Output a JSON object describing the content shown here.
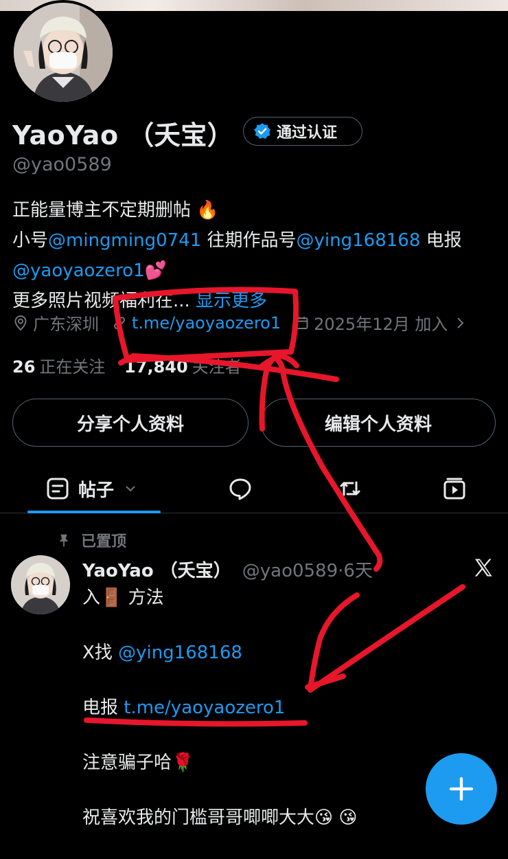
{
  "profile": {
    "name": "YaoYao （夭宝）",
    "verified_label": "通过认证",
    "handle": "@yao0589",
    "bio_line1": "正能量博主不定期删帖 🔥",
    "bio_line2_prefix": "小号",
    "bio_line2_link1": "@mingming0741",
    "bio_line2_mid": " 往期作品号",
    "bio_line2_link2": "@ying168168",
    "bio_line2_suffix": " 电报",
    "bio_line3_link": "@yaoyaozero1",
    "bio_line3_emoji": "💕",
    "bio_line4": "更多照片视频福利在...",
    "bio_line4_more": " 显示更多",
    "location": "广东深圳",
    "website": "t.me/yaoyaozero1",
    "joined": "2025年12月 加入",
    "following_count": "26",
    "following_label": "正在关注",
    "followers_count": "17,840",
    "followers_label": "关注者"
  },
  "buttons": {
    "share": "分享个人资料",
    "edit": "编辑个人资料"
  },
  "tabs": {
    "posts": "帖子"
  },
  "post": {
    "pinned_label": "已置顶",
    "author_name": "YaoYao （夭宝）",
    "author_handle": "@yao0589·6天",
    "line1": "入🚪 方法",
    "line2_prefix": "X找 ",
    "line2_link": "@ying168168",
    "line3_prefix": "电报 ",
    "line3_link": "t.me/yaoyaozero1",
    "line4": "注意骗子哈🌹",
    "line5": "祝喜欢我的门槛哥哥唧唧大大😘 😘"
  },
  "colors": {
    "background": "#000000",
    "accent": "#1d9bf0",
    "muted": "#71767b",
    "annotation": "#e8162b"
  },
  "icons": [
    "verified-badge-icon",
    "location-icon",
    "link-icon",
    "calendar-icon",
    "posts-tab-icon",
    "chevron-down-icon",
    "replies-icon",
    "retweet-icon",
    "media-icon",
    "pin-icon",
    "x-logo-icon",
    "plus-icon"
  ]
}
